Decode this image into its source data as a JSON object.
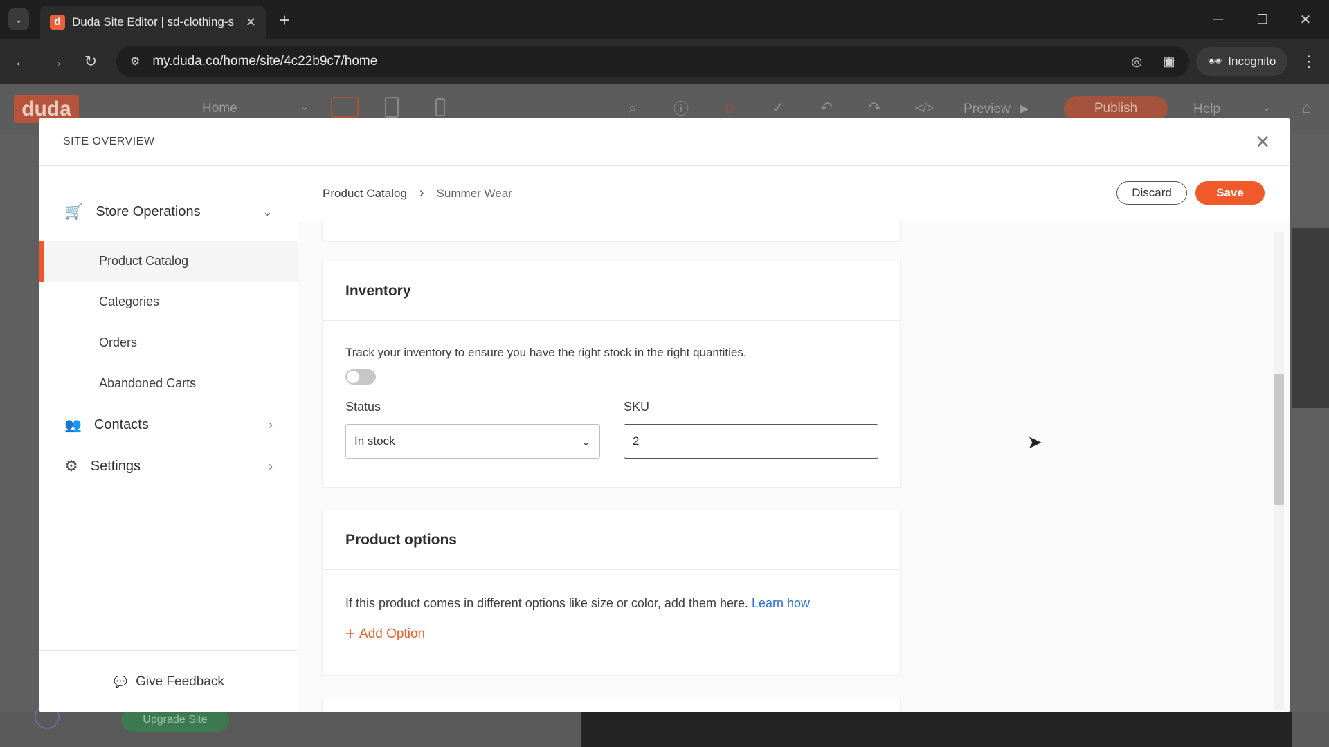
{
  "browser": {
    "tab_title": "Duda Site Editor | sd-clothing-s",
    "url": "my.duda.co/home/site/4c22b9c7/home",
    "incognito_label": "Incognito",
    "favicon_letter": "d"
  },
  "editor": {
    "logo": "duda",
    "page_select": "Home",
    "preview_label": "Preview",
    "publish_label": "Publish",
    "help_label": "Help",
    "upgrade_label": "Upgrade Site"
  },
  "modal": {
    "title": "SITE OVERVIEW",
    "sidebar": {
      "store_operations": "Store Operations",
      "store_items": [
        "Product Catalog",
        "Categories",
        "Orders",
        "Abandoned Carts"
      ],
      "contacts": "Contacts",
      "settings": "Settings",
      "feedback": "Give Feedback"
    },
    "breadcrumb": {
      "parent": "Product Catalog",
      "current": "Summer Wear"
    },
    "actions": {
      "discard": "Discard",
      "save": "Save"
    },
    "inventory": {
      "title": "Inventory",
      "description": "Track your inventory to ensure you have the right stock in the right quantities.",
      "status_label": "Status",
      "status_value": "In stock",
      "sku_label": "SKU",
      "sku_value": "2",
      "tracking_enabled": false
    },
    "product_options": {
      "title": "Product options",
      "description": "If this product comes in different options like size or color, add them here.",
      "learn_link": "Learn how",
      "add_label": "Add Option"
    }
  },
  "colors": {
    "accent": "#f05a2a",
    "link": "#2a6fdb"
  }
}
